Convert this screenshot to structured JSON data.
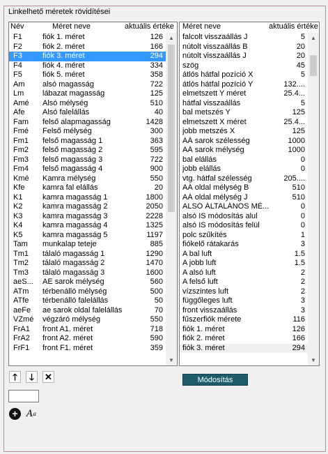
{
  "group": {
    "title": "Linkelhető méretek rövidítései"
  },
  "left_list": {
    "headers": {
      "name": "Név",
      "size_name": "Méret neve",
      "current_value": "aktuális értéke"
    },
    "rows": [
      {
        "name": "F1",
        "label": "fiók 1. méret",
        "value": "126"
      },
      {
        "name": "F2",
        "label": "fiók 2. méret",
        "value": "166"
      },
      {
        "name": "F3",
        "label": "fiók 3. méret",
        "value": "294"
      },
      {
        "name": "F4",
        "label": "fiók 4. méret",
        "value": "334"
      },
      {
        "name": "F5",
        "label": "fiók 5. méret",
        "value": "358"
      },
      {
        "name": "Am",
        "label": "alsó magasság",
        "value": "722"
      },
      {
        "name": "Lm",
        "label": "lábazat magasság",
        "value": "125"
      },
      {
        "name": "Amé",
        "label": "Alsó mélység",
        "value": "510"
      },
      {
        "name": "Afe",
        "label": "Alsó falelállás",
        "value": "40"
      },
      {
        "name": "Fam",
        "label": "felső alapmagasság",
        "value": "1428"
      },
      {
        "name": "Fmé",
        "label": "Felső mélység",
        "value": "300"
      },
      {
        "name": "Fm1",
        "label": "felső magasság 1",
        "value": "363"
      },
      {
        "name": "Fm2",
        "label": "felső magasság 2",
        "value": "595"
      },
      {
        "name": "Fm3",
        "label": "felső magasság 3",
        "value": "722"
      },
      {
        "name": "Fm4",
        "label": "felső magasság 4",
        "value": "900"
      },
      {
        "name": "Kmé",
        "label": "Kamra mélység",
        "value": "550"
      },
      {
        "name": "Kfe",
        "label": "kamra fal elállás",
        "value": "20"
      },
      {
        "name": "K1",
        "label": "kamra magasság 1",
        "value": "1800"
      },
      {
        "name": "K2",
        "label": "kamra magasság 2",
        "value": "2050"
      },
      {
        "name": "K3",
        "label": "kamra magasság 3",
        "value": "2228"
      },
      {
        "name": "K4",
        "label": "kamra magasság 4",
        "value": "1325"
      },
      {
        "name": "K5",
        "label": "kamra magasság 5",
        "value": "1197"
      },
      {
        "name": "Tam",
        "label": "munkalap teteje",
        "value": "885"
      },
      {
        "name": "Tm1",
        "label": "tálaló magasság 1",
        "value": "1290"
      },
      {
        "name": "Tm2",
        "label": "tálaló magasság 2",
        "value": "1470"
      },
      {
        "name": "Tm3",
        "label": "tálaló magasság 3",
        "value": "1600"
      },
      {
        "name": "aeS...",
        "label": "AE sarok mélység",
        "value": "560"
      },
      {
        "name": "ATm",
        "label": "térbenálló mélység",
        "value": "500"
      },
      {
        "name": "ATfe",
        "label": "térbenálló falelállás",
        "value": "50"
      },
      {
        "name": "aeFe",
        "label": "ae sarok oldal falelállás",
        "value": "70"
      },
      {
        "name": "VZmé",
        "label": "végzáró mélység",
        "value": "550"
      },
      {
        "name": "FrA1",
        "label": "front A1. méret",
        "value": "718"
      },
      {
        "name": "FrA2",
        "label": "front A2. méret",
        "value": "590"
      },
      {
        "name": "FrF1",
        "label": "front F1. méret",
        "value": "359"
      }
    ],
    "selected_index": 2
  },
  "right_list": {
    "headers": {
      "size_name": "Méret neve",
      "current_value": "aktuális értéke"
    },
    "rows": [
      {
        "label": "falcolt visszaállás J",
        "value": "5"
      },
      {
        "label": "nútolt visszaállás B",
        "value": "20"
      },
      {
        "label": "nútolt visszaállás J",
        "value": "20"
      },
      {
        "label": "szög",
        "value": "45"
      },
      {
        "label": "átlós hátfal pozíció X",
        "value": "5"
      },
      {
        "label": "átlós hátfal pozíció Y",
        "value": "132...."
      },
      {
        "label": "elmetszett Y méret",
        "value": "25.4..."
      },
      {
        "label": "hátfal visszaállás",
        "value": "5"
      },
      {
        "label": "bal metszés Y",
        "value": "125"
      },
      {
        "label": "elmetszett X méret",
        "value": "25.4..."
      },
      {
        "label": "jobb metszés X",
        "value": "125"
      },
      {
        "label": "AÁ sarok szélesség",
        "value": "1000"
      },
      {
        "label": "AÁ sarok mélység",
        "value": "1000"
      },
      {
        "label": "bal elállás",
        "value": "0"
      },
      {
        "label": "jobb elállás",
        "value": "0"
      },
      {
        "label": "vtg. hátfal szélesség",
        "value": "205...."
      },
      {
        "label": "AÁ oldal mélység B",
        "value": "510"
      },
      {
        "label": "AÁ oldal mélység J",
        "value": "510"
      },
      {
        "label": "ALSÓ ÁLTALÁNOS MÉ...",
        "value": "0"
      },
      {
        "label": "alsó IS módosítás alul",
        "value": "0"
      },
      {
        "label": "alsó IS módosítás felül",
        "value": "0"
      },
      {
        "label": "polc szűkítés",
        "value": "1"
      },
      {
        "label": "fiókelő rátakarás",
        "value": "3"
      },
      {
        "label": "A bal luft",
        "value": "1.5"
      },
      {
        "label": "A jobb luft",
        "value": "1.5"
      },
      {
        "label": "A alsó luft",
        "value": "2"
      },
      {
        "label": "A felső luft",
        "value": "2"
      },
      {
        "label": "vízszintes luft",
        "value": "2"
      },
      {
        "label": "függőleges luft",
        "value": "3"
      },
      {
        "label": "front visszaállás",
        "value": "3"
      },
      {
        "label": "fűszerfiók mérete",
        "value": "116"
      },
      {
        "label": "fiók 1. méret",
        "value": "126"
      },
      {
        "label": "fiók 2. méret",
        "value": "166"
      },
      {
        "label": "fiók 3. méret",
        "value": "294"
      }
    ],
    "selected_index": 33
  },
  "buttons": {
    "modify": "Módosítás"
  },
  "icons": {
    "move_up": "arrow-up-icon",
    "move_down": "arrow-down-icon",
    "delete": "close-icon",
    "add": "plus-icon",
    "font": "font-icon"
  },
  "colors": {
    "selection": "#3399ff",
    "modify_button": "#1e5b6b",
    "group_border": "#b88a93"
  }
}
